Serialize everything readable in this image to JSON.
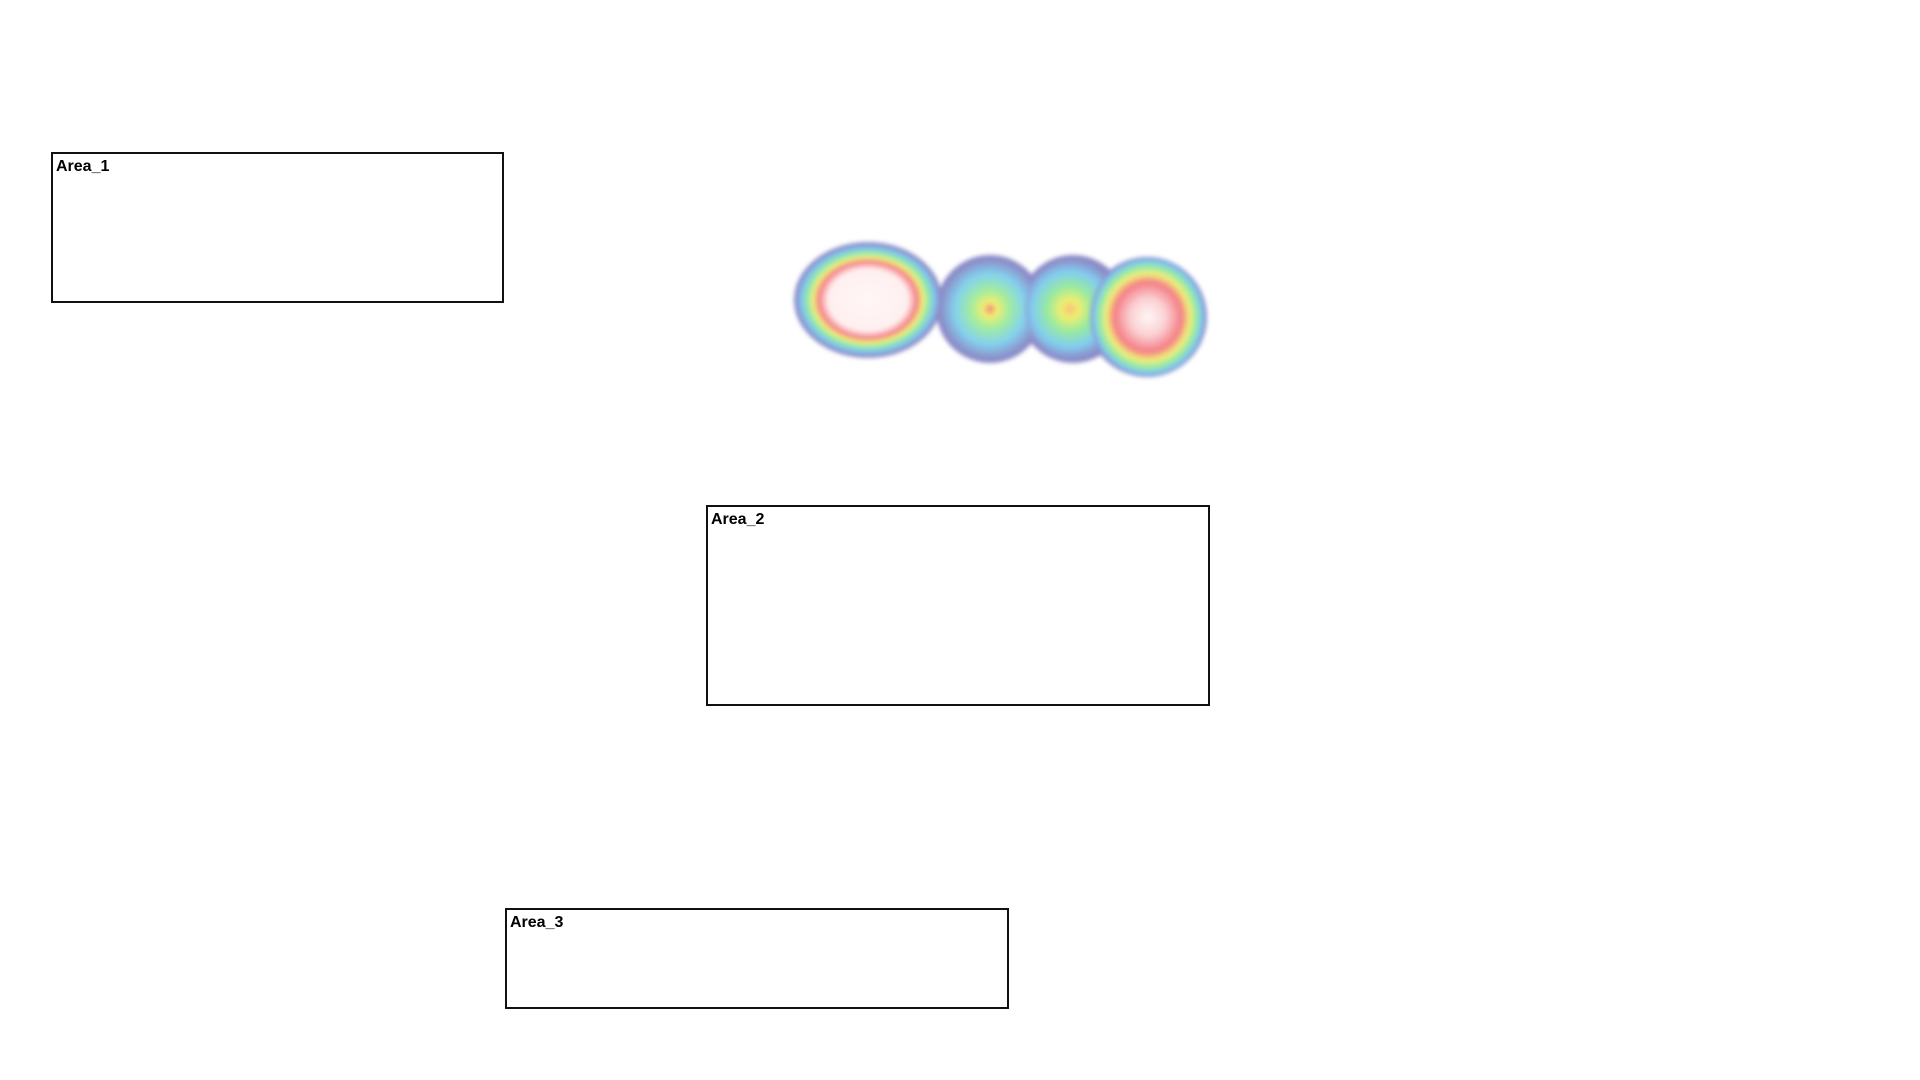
{
  "areas": [
    {
      "label": "Area_1"
    },
    {
      "label": "Area_2"
    },
    {
      "label": "Area_3"
    }
  ],
  "heatmap": {
    "hotspots": [
      {
        "intensity": 1.0
      },
      {
        "intensity": 0.55
      },
      {
        "intensity": 0.6
      },
      {
        "intensity": 0.95
      }
    ],
    "palette": [
      "#8c8cc8",
      "#7ec8f0",
      "#8ee8a8",
      "#f0f070",
      "#f08080",
      "#fff4f4"
    ]
  }
}
